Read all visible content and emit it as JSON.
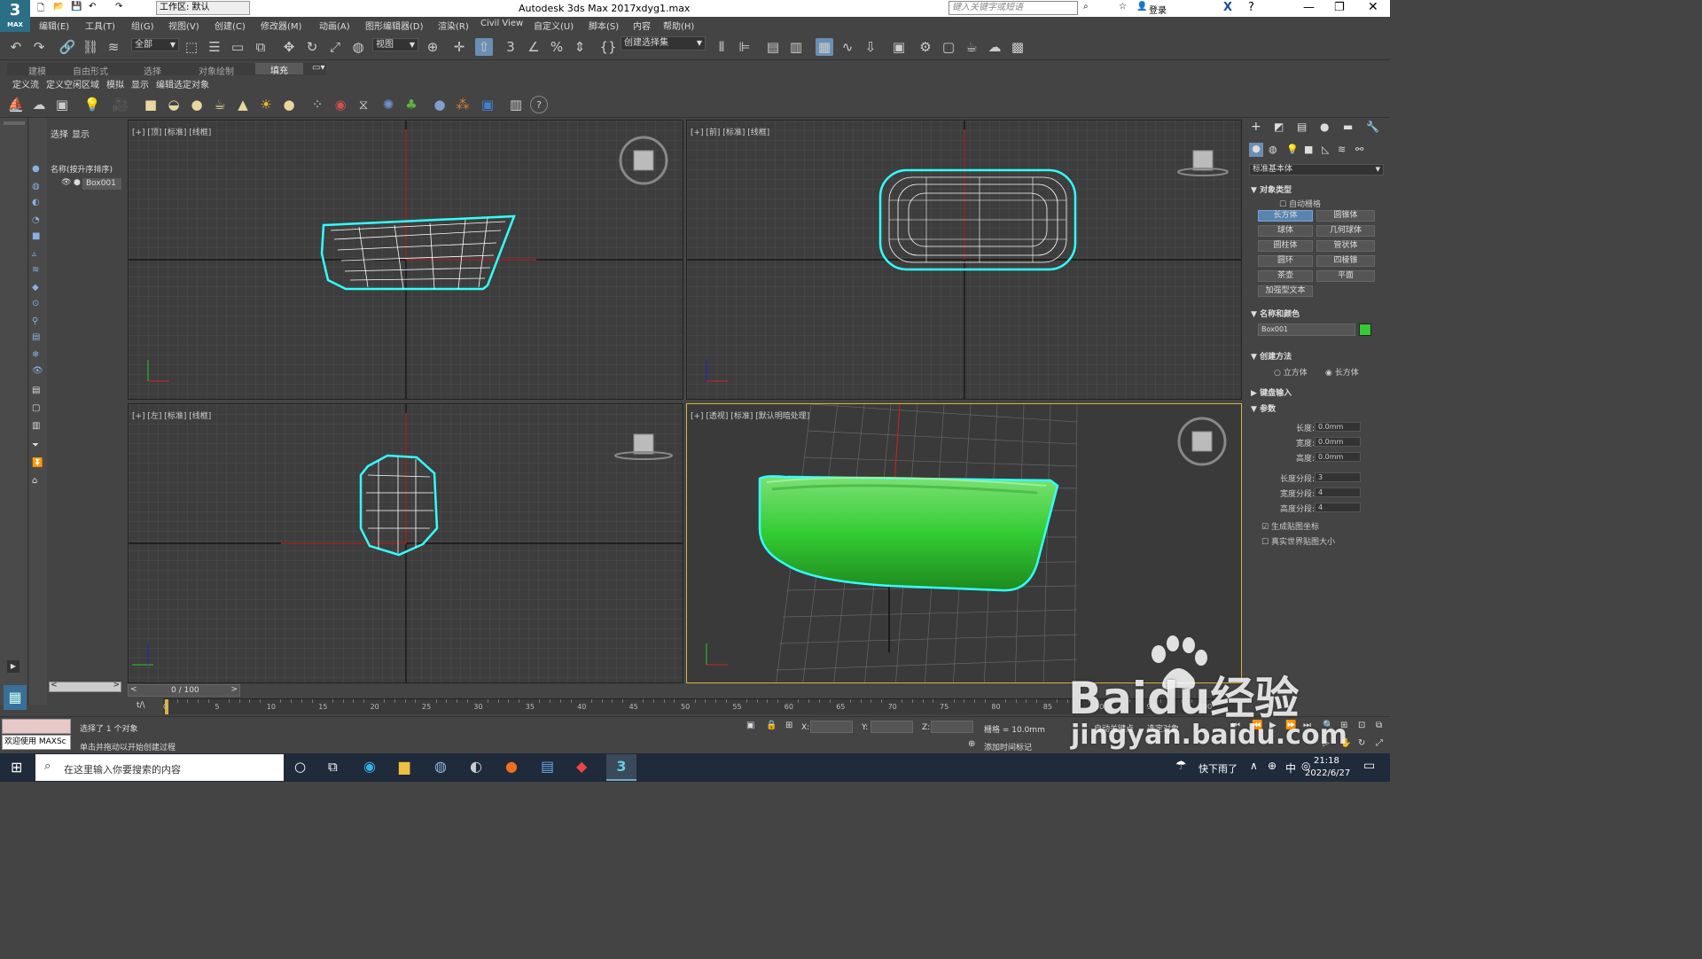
{
  "title": {
    "workspace_label": "工作区: 默认",
    "app_title": "Autodesk 3ds Max 2017",
    "filename": "xdyg1.max",
    "search_placeholder": "键入关键字或短语",
    "login": "登录"
  },
  "app_icon": {
    "number": "3",
    "text": "MAX"
  },
  "menu": [
    "编辑(E)",
    "工具(T)",
    "组(G)",
    "视图(V)",
    "创建(C)",
    "修改器(M)",
    "动画(A)",
    "图形编辑器(D)",
    "渲染(R)",
    "Civil View",
    "自定义(U)",
    "脚本(S)",
    "内容",
    "帮助(H)"
  ],
  "toolbar": {
    "filter": "全部",
    "refcoord": "视图",
    "selset": "创建选择集"
  },
  "ribbon": {
    "tabs": [
      "建模",
      "自由形式",
      "选择",
      "对象绘制",
      "填充"
    ],
    "subtabs": [
      "定义流",
      "定义空闲区域",
      "模拟",
      "显示",
      "编辑选定对象"
    ]
  },
  "scene": {
    "tabs": [
      "选择",
      "显示"
    ],
    "header": "名称(按升序排序)",
    "item": "Box001"
  },
  "viewports": {
    "top": "[+] [顶] [标准] [线框]",
    "front": "[+] [前] [标准] [线框]",
    "left": "[+] [左] [标准] [线框]",
    "persp": "[+] [透视] [标准] [默认明暗处理]"
  },
  "cmd": {
    "dropdown": "标准基本体",
    "s1": "对象类型",
    "autogrid": "自动栅格",
    "buttons": [
      "长方体",
      "圆锥体",
      "球体",
      "几何球体",
      "圆柱体",
      "管状体",
      "圆环",
      "四棱锥",
      "茶壶",
      "平面",
      "加强型文本"
    ],
    "s2": "名称和颜色",
    "objname": "Box001",
    "objcolor": "#33cc33",
    "s3": "创建方法",
    "m1": "立方体",
    "m2": "长方体",
    "s4": "键盘输入",
    "s5": "参数",
    "params": [
      {
        "label": "长度:",
        "value": "0.0mm"
      },
      {
        "label": "宽度:",
        "value": "0.0mm"
      },
      {
        "label": "高度:",
        "value": "0.0mm"
      },
      {
        "label": "长度分段:",
        "value": "3"
      },
      {
        "label": "宽度分段:",
        "value": "4"
      },
      {
        "label": "高度分段:",
        "value": "4"
      }
    ],
    "c1": "生成贴图坐标",
    "c2": "真实世界贴图大小"
  },
  "timeline": {
    "counter": "0 / 100",
    "ticks": [
      "0",
      "5",
      "10",
      "15",
      "20",
      "25",
      "30",
      "35",
      "40",
      "45",
      "50",
      "55",
      "60",
      "65",
      "70",
      "75",
      "80",
      "85",
      "90",
      "95",
      "100"
    ]
  },
  "status": {
    "script": "欢迎使用 MAXSc",
    "line1": "选择了 1 个对象",
    "line2": "单击并拖动以开始创建过程",
    "x": "X:",
    "y": "Y:",
    "z": "Z:",
    "grid": "栅格 = 10.0mm",
    "addtime": "添加时间标记",
    "autokey": "自动关键点",
    "selobj": "选定对象"
  },
  "taskbar": {
    "search": "在这里输入你要搜索的内容",
    "weather": "快下雨了",
    "ime": "中",
    "time": "21:18",
    "date": "2022/6/27"
  },
  "watermark": {
    "brand": "Baidu经验",
    "url": "jingyan.baidu.com"
  }
}
